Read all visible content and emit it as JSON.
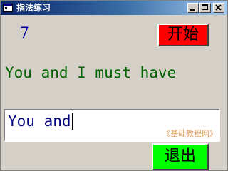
{
  "window": {
    "title": "指法练习",
    "icon": "app-window-icon"
  },
  "counter": "7",
  "start_button": {
    "label": "开始",
    "color": "#ff0000"
  },
  "target_text": "You and I must have",
  "input": {
    "value": "You and",
    "watermark": "《基础教程网》"
  },
  "exit_button": {
    "label": "退出",
    "color": "#00ff00"
  },
  "colors": {
    "counter": "#0000a0",
    "target_text": "#006400",
    "input_text": "#000080",
    "face": "#d4d0c8"
  }
}
